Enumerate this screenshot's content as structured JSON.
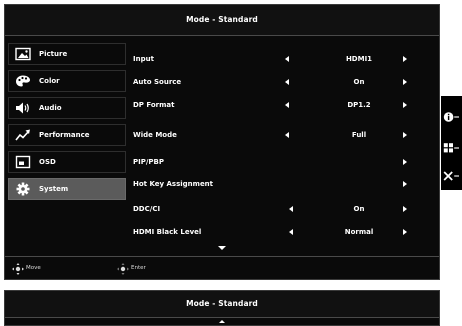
{
  "osd": {
    "title": "Mode - Standard",
    "sidebar": [
      {
        "label": "Picture",
        "icon": "picture-icon",
        "selected": false
      },
      {
        "label": "Color",
        "icon": "palette-icon",
        "selected": false
      },
      {
        "label": "Audio",
        "icon": "speaker-icon",
        "selected": false
      },
      {
        "label": "Performance",
        "icon": "performance-graph-icon",
        "selected": false
      },
      {
        "label": "OSD",
        "icon": "osd-window-icon",
        "selected": false
      },
      {
        "label": "System",
        "icon": "gear-icon",
        "selected": true
      }
    ],
    "rows": [
      {
        "label": "Input",
        "value": "HDMI1"
      },
      {
        "label": "Auto Source",
        "value": "On"
      },
      {
        "label": "DP Format",
        "value": "DP1.2"
      },
      {
        "label": "Wide Mode",
        "value": "Full"
      },
      {
        "label": "PIP/PBP",
        "value": ""
      },
      {
        "label": "Hot Key Assignment",
        "value": ""
      },
      {
        "label": "DDC/CI",
        "value": "On"
      },
      {
        "label": "HDMI Black Level",
        "value": "Normal"
      }
    ],
    "footer": {
      "move_label": "Move",
      "enter_label": "Enter"
    }
  },
  "side_panel": {
    "icons": [
      "info-icon",
      "menu-grid-icon",
      "close-icon"
    ]
  },
  "osd_secondary": {
    "title": "Mode - Standard"
  },
  "colors": {
    "background": "#0a0a0a",
    "selected": "#5b5b5b",
    "text": "#ffffff"
  }
}
